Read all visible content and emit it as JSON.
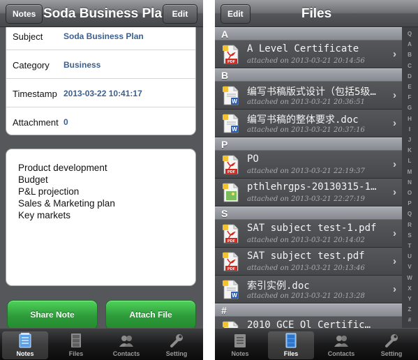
{
  "left": {
    "nav": {
      "back_label": "Notes",
      "title": "Soda Business Plan",
      "edit_label": "Edit"
    },
    "fields": [
      {
        "label": "Subject",
        "value": "Soda Business Plan"
      },
      {
        "label": "Category",
        "value": "Business"
      },
      {
        "label": "Timestamp",
        "value": "2013-03-22 10:41:17"
      },
      {
        "label": "Attachment",
        "value": "0"
      }
    ],
    "body_lines": [
      "Product development",
      "Budget",
      "P&L projection",
      "Sales & Marketing plan",
      "Key markets"
    ],
    "share_label": "Share Note",
    "attach_label": "Attach File"
  },
  "right": {
    "nav": {
      "edit_label": "Edit",
      "title": "Files"
    },
    "sections": [
      {
        "letter": "A",
        "files": [
          {
            "name": "A Level Certificate",
            "meta": "attached on 2013-03-21 20:14:56",
            "type": "pdf"
          }
        ]
      },
      {
        "letter": "B",
        "files": [
          {
            "name": "编写书稿版式设计（包括5级…",
            "meta": "attached on 2013-03-21 20:36:51",
            "type": "word"
          },
          {
            "name": "编写书稿的整体要求.doc",
            "meta": "attached on 2013-03-21 20:37:16",
            "type": "word"
          }
        ]
      },
      {
        "letter": "P",
        "files": [
          {
            "name": "PO",
            "meta": "attached on 2013-03-21 22:19:37",
            "type": "pdf"
          },
          {
            "name": "pthlehrgps-20130315-1…",
            "meta": "attached on 2013-03-21 22:27:19",
            "type": "image"
          }
        ]
      },
      {
        "letter": "S",
        "files": [
          {
            "name": "SAT subject test-1.pdf",
            "meta": "attached on 2013-03-21 20:14:02",
            "type": "pdf"
          },
          {
            "name": "SAT subject test.pdf",
            "meta": "attached on 2013-03-21 20:13:46",
            "type": "pdf"
          },
          {
            "name": "索引实例.doc",
            "meta": "attached on 2013-03-21 20:13:28",
            "type": "word"
          }
        ]
      },
      {
        "letter": "#",
        "files": [
          {
            "name": "2010 GCE Ol Certific…",
            "meta": "",
            "type": "pdf"
          }
        ]
      }
    ],
    "index_letters": [
      "Q",
      "A",
      "B",
      "C",
      "D",
      "E",
      "F",
      "G",
      "H",
      "I",
      "J",
      "K",
      "L",
      "M",
      "N",
      "O",
      "P",
      "Q",
      "R",
      "S",
      "T",
      "U",
      "V",
      "W",
      "X",
      "Y",
      "Z",
      "#"
    ]
  },
  "tabs": [
    {
      "label": "Notes",
      "icon": "notepad-icon"
    },
    {
      "label": "Files",
      "icon": "file-cabinet-icon"
    },
    {
      "label": "Contacts",
      "icon": "contacts-icon"
    },
    {
      "label": "Setting",
      "icon": "wrench-icon"
    }
  ],
  "colors": {
    "field_value": "#3b5f8f",
    "green_button": "#2e9a3a",
    "pdf_red": "#d9261c",
    "word_blue": "#2b5fb4"
  }
}
